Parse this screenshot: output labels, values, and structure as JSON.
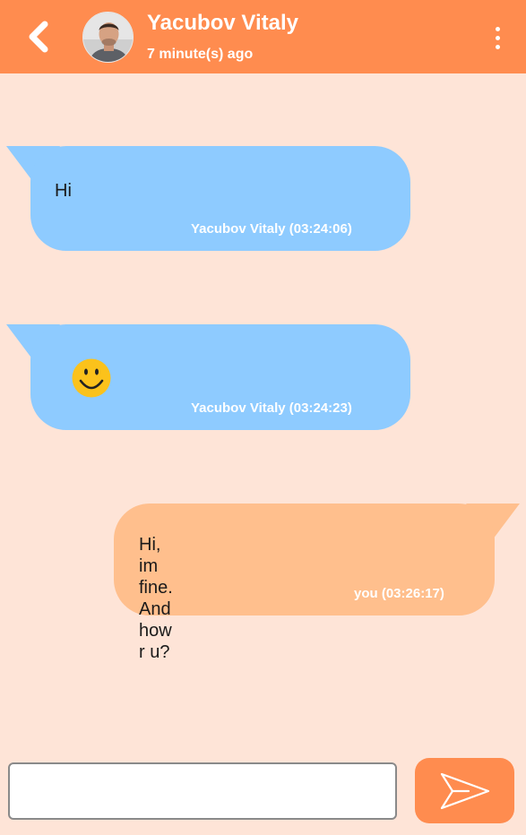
{
  "header": {
    "contact_name": "Yacubov Vitaly",
    "last_seen": "7 minute(s) ago",
    "back_icon": "chevron-left-icon",
    "menu_icon": "more-vertical-icon"
  },
  "messages": [
    {
      "direction": "incoming",
      "text": "Hi",
      "meta": "Yacubov Vitaly (03:24:06)"
    },
    {
      "direction": "incoming",
      "emoji": "smiley-face-icon",
      "meta": "Yacubov Vitaly (03:24:23)"
    },
    {
      "direction": "outgoing",
      "text": "Hi, im fine. And how r u?",
      "meta": "you (03:26:17)"
    }
  ],
  "composer": {
    "value": "",
    "placeholder": "",
    "send_icon": "paper-plane-icon"
  },
  "colors": {
    "header": "#ff8c4f",
    "background": "#fee4d7",
    "incoming_bubble": "#8ecbff",
    "outgoing_bubble": "#ffbf8d",
    "send_button": "#ff8c4f"
  }
}
